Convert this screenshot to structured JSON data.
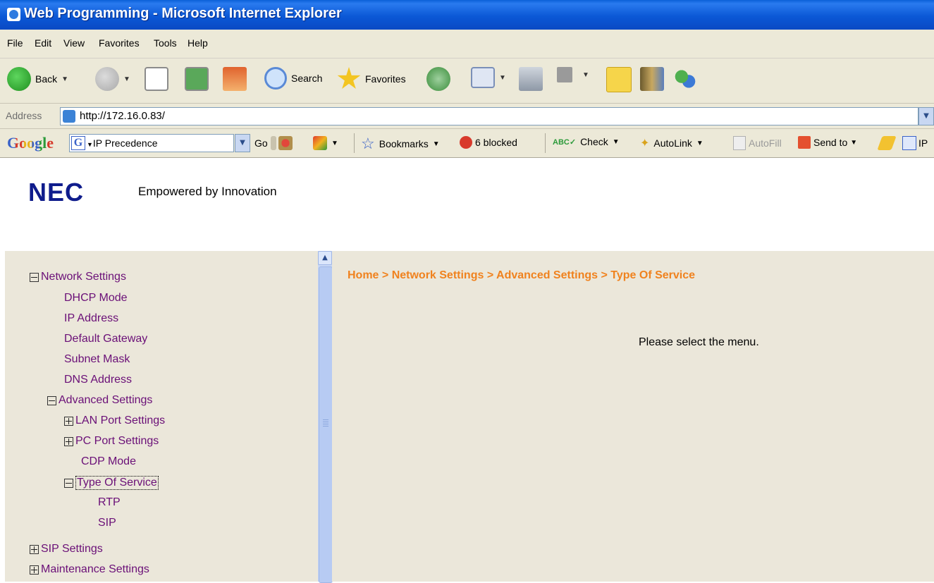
{
  "window": {
    "title": "Web Programming - Microsoft Internet Explorer"
  },
  "menu": [
    "File",
    "Edit",
    "View",
    "Favorites",
    "Tools",
    "Help"
  ],
  "toolbar": {
    "back_label": "Back",
    "search_label": "Search",
    "favorites_label": "Favorites"
  },
  "address": {
    "label": "Address",
    "url": "http://172.16.0.83/"
  },
  "google_toolbar": {
    "logo": "Google",
    "search_value": "IP Precedence",
    "go_label": "Go",
    "bookmarks_label": "Bookmarks",
    "blocked_label": "6 blocked",
    "check_label": "Check",
    "autolink_label": "AutoLink",
    "autofill_label": "AutoFill",
    "sendto_label": "Send to",
    "ip_label": "IP"
  },
  "header": {
    "logo": "NEC",
    "tagline": "Empowered by Innovation"
  },
  "breadcrumb": "Home > Network Settings > Advanced Settings > Type Of Service",
  "message": "Please select the menu.",
  "tree": {
    "network_settings": "Network Settings",
    "dhcp_mode": "DHCP Mode",
    "ip_address": "IP Address",
    "default_gateway": "Default Gateway",
    "subnet_mask": "Subnet Mask",
    "dns_address": "DNS Address",
    "advanced_settings": "Advanced Settings",
    "lan_port_settings": "LAN Port Settings",
    "pc_port_settings": "PC Port Settings",
    "cdp_mode": "CDP Mode",
    "type_of_service": "Type Of Service",
    "rtp": "RTP",
    "sip": "SIP",
    "sip_settings": "SIP Settings",
    "maintenance_settings": "Maintenance Settings"
  },
  "colors": {
    "breadcrumb": "#f0821e",
    "tree_link": "#6a0f77",
    "nec_blue": "#0f1c8c",
    "pane_bg": "#ebe7da"
  }
}
